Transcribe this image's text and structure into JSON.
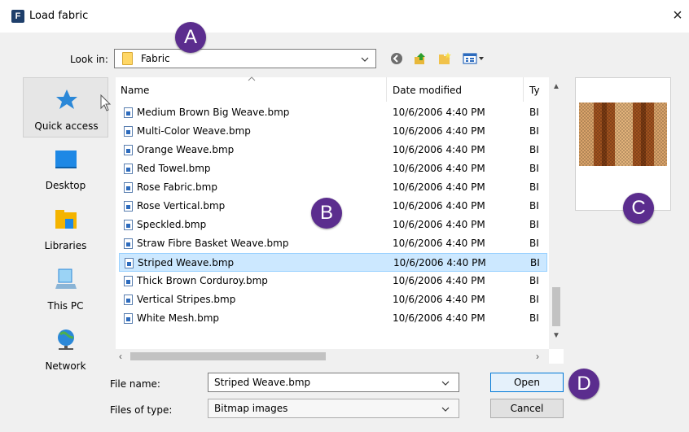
{
  "window": {
    "title": "Load fabric",
    "app_icon_letter": "F",
    "close_glyph": "×"
  },
  "lookin": {
    "label": "Look in:",
    "value": "Fabric"
  },
  "toolbar": {
    "icons": [
      "back-icon",
      "up-folder-icon",
      "new-folder-icon",
      "view-menu-icon"
    ]
  },
  "places": [
    {
      "label": "Quick access",
      "icon": "star-icon",
      "selected": true
    },
    {
      "label": "Desktop",
      "icon": "desktop-icon"
    },
    {
      "label": "Libraries",
      "icon": "libraries-icon"
    },
    {
      "label": "This PC",
      "icon": "computer-icon"
    },
    {
      "label": "Network",
      "icon": "network-icon"
    }
  ],
  "filelist": {
    "columns": {
      "name": "Name",
      "date": "Date modified",
      "type": "Ty"
    },
    "rows": [
      {
        "name": "Medium Brown Big Weave.bmp",
        "date": "10/6/2006 4:40 PM",
        "type": "BI"
      },
      {
        "name": "Multi-Color Weave.bmp",
        "date": "10/6/2006 4:40 PM",
        "type": "BI"
      },
      {
        "name": "Orange Weave.bmp",
        "date": "10/6/2006 4:40 PM",
        "type": "BI"
      },
      {
        "name": "Red Towel.bmp",
        "date": "10/6/2006 4:40 PM",
        "type": "BI"
      },
      {
        "name": "Rose Fabric.bmp",
        "date": "10/6/2006 4:40 PM",
        "type": "BI"
      },
      {
        "name": "Rose Vertical.bmp",
        "date": "10/6/2006 4:40 PM",
        "type": "BI"
      },
      {
        "name": "Speckled.bmp",
        "date": "10/6/2006 4:40 PM",
        "type": "BI"
      },
      {
        "name": "Straw Fibre Basket Weave.bmp",
        "date": "10/6/2006 4:40 PM",
        "type": "BI"
      },
      {
        "name": "Striped Weave.bmp",
        "date": "10/6/2006 4:40 PM",
        "type": "BI",
        "selected": true
      },
      {
        "name": "Thick Brown Corduroy.bmp",
        "date": "10/6/2006 4:40 PM",
        "type": "BI"
      },
      {
        "name": "Vertical Stripes.bmp",
        "date": "10/6/2006 4:40 PM",
        "type": "BI"
      },
      {
        "name": "White Mesh.bmp",
        "date": "10/6/2006 4:40 PM",
        "type": "BI"
      }
    ]
  },
  "bottom": {
    "filename_label": "File name:",
    "filename_value": "Striped Weave.bmp",
    "filetype_label": "Files of type:",
    "filetype_value": "Bitmap images",
    "open_label": "Open",
    "cancel_label": "Cancel"
  },
  "callouts": {
    "a": "A",
    "b": "B",
    "c": "C",
    "d": "D"
  },
  "colors": {
    "callout": "#5b2d8e",
    "selection": "#cce8ff",
    "accent": "#0078d7"
  }
}
